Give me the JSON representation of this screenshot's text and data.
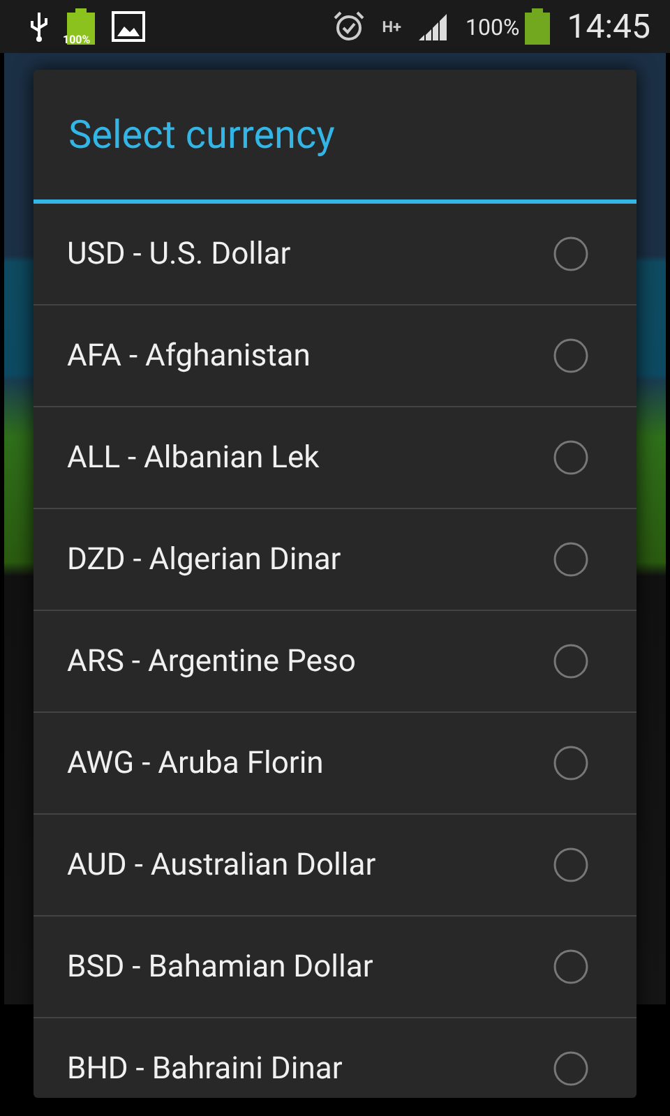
{
  "status_bar": {
    "battery_badge": "100%",
    "network": "H+",
    "battery_percent": "100%",
    "time": "14:45"
  },
  "dialog": {
    "title": "Select currency",
    "options": [
      {
        "label": "USD - U.S. Dollar",
        "selected": false
      },
      {
        "label": "AFA - Afghanistan",
        "selected": false
      },
      {
        "label": "ALL - Albanian Lek",
        "selected": false
      },
      {
        "label": "DZD - Algerian Dinar",
        "selected": false
      },
      {
        "label": "ARS - Argentine Peso",
        "selected": false
      },
      {
        "label": "AWG - Aruba Florin",
        "selected": false
      },
      {
        "label": "AUD - Australian Dollar",
        "selected": false
      },
      {
        "label": "BSD - Bahamian Dollar",
        "selected": false
      },
      {
        "label": "BHD - Bahraini Dinar",
        "selected": false
      }
    ]
  }
}
